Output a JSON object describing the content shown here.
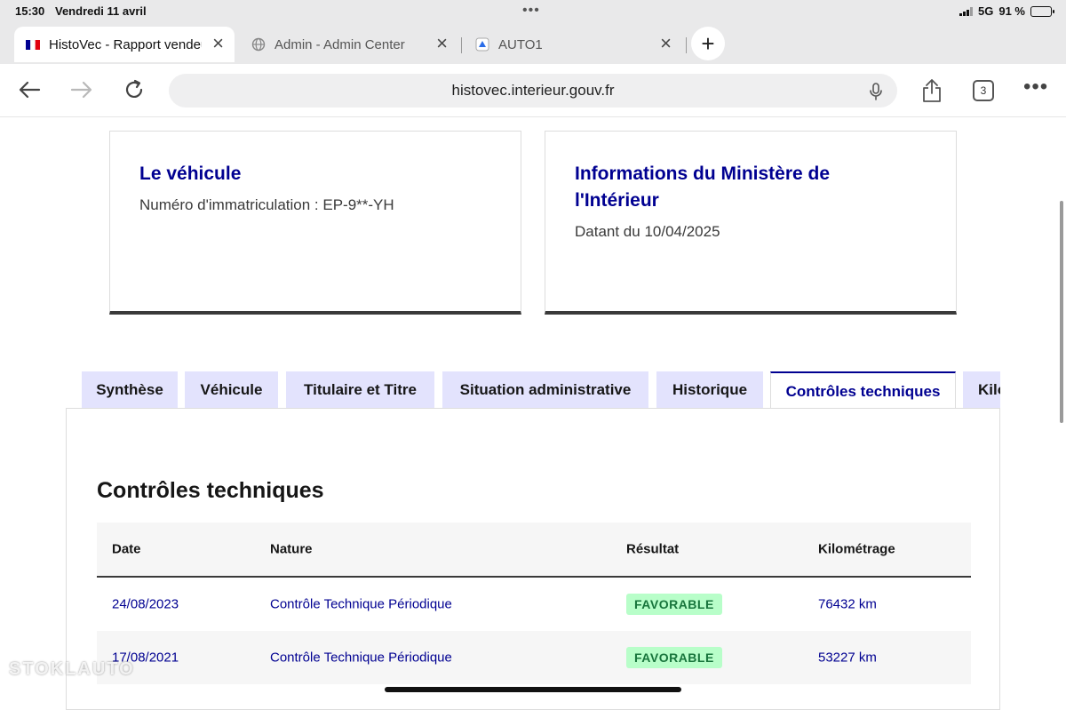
{
  "status_bar": {
    "time": "15:30",
    "date": "Vendredi 11 avril",
    "network": "5G",
    "battery": "91 %",
    "battery_level": 0.91
  },
  "browser": {
    "tabs": [
      {
        "title": "HistoVec - Rapport vendeur",
        "icon": "french-flag-icon",
        "active": true
      },
      {
        "title": "Admin - Admin Center",
        "icon": "globe-icon",
        "active": false
      },
      {
        "title": "AUTO1",
        "icon": "auto1-icon",
        "active": false
      }
    ],
    "new_tab_label": "+",
    "url": "histovec.interieur.gouv.fr",
    "tab_count": "3"
  },
  "page": {
    "vehicle_card": {
      "title": "Le véhicule",
      "text": "Numéro d'immatriculation : EP-9**-YH"
    },
    "ministry_card": {
      "title_line1": "Informations du Ministère de",
      "title_line2": "l'Intérieur",
      "text": "Datant du 10/04/2025"
    },
    "tabs": [
      {
        "label": "Synthèse",
        "active": false
      },
      {
        "label": "Véhicule",
        "active": false
      },
      {
        "label": "Titulaire et Titre",
        "active": false
      },
      {
        "label": "Situation administrative",
        "active": false
      },
      {
        "label": "Historique",
        "active": false
      },
      {
        "label": "Contrôles techniques",
        "active": true
      },
      {
        "label": "Kilo",
        "active": false
      }
    ],
    "section_title": "Contrôles techniques",
    "table": {
      "headers": [
        "Date",
        "Nature",
        "Résultat",
        "Kilométrage"
      ],
      "rows": [
        {
          "date": "24/08/2023",
          "nature": "Contrôle Technique Périodique",
          "result": "FAVORABLE",
          "mileage": "76432 km"
        },
        {
          "date": "17/08/2021",
          "nature": "Contrôle Technique Périodique",
          "result": "FAVORABLE",
          "mileage": "53227 km"
        }
      ]
    }
  },
  "colors": {
    "brand_blue": "#000091",
    "tab_bg": "#e3e3fd",
    "badge_bg": "#b8fec9",
    "badge_text": "#18753c"
  },
  "watermark": "STOKLAUTO"
}
